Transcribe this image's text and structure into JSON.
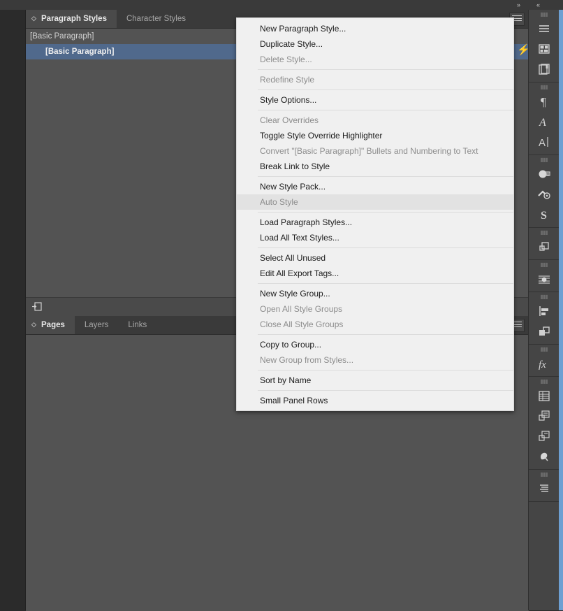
{
  "topbar": {
    "expand_icon": "double-chevron-right",
    "collapse_icon": "double-chevron-left",
    "expand_glyph": "»",
    "collapse_glyph": "«"
  },
  "paragraph_styles_panel": {
    "tabs": [
      {
        "label": "Paragraph Styles",
        "active": true
      },
      {
        "label": "Character Styles",
        "active": false
      }
    ],
    "header_label": "[Basic Paragraph]",
    "rows": [
      {
        "label": "[Basic Paragraph]",
        "selected": true
      }
    ],
    "quick_apply_icon": "lightning-bolt-icon",
    "quick_apply_glyph": "⚡",
    "footer_icon": "new-style-icon",
    "menu_icon": "panel-menu-icon"
  },
  "pages_panel": {
    "tabs": [
      {
        "label": "Pages",
        "active": true
      },
      {
        "label": "Layers",
        "active": false
      },
      {
        "label": "Links",
        "active": false
      }
    ],
    "menu_icon": "panel-menu-icon"
  },
  "context_menu": {
    "items": [
      {
        "label": "New Paragraph Style...",
        "disabled": false,
        "hover": false,
        "sep_after": false
      },
      {
        "label": "Duplicate Style...",
        "disabled": false,
        "hover": false,
        "sep_after": false
      },
      {
        "label": "Delete Style...",
        "disabled": true,
        "hover": false,
        "sep_after": true
      },
      {
        "label": "Redefine Style",
        "disabled": true,
        "hover": false,
        "sep_after": true
      },
      {
        "label": "Style Options...",
        "disabled": false,
        "hover": false,
        "sep_after": true
      },
      {
        "label": "Clear Overrides",
        "disabled": true,
        "hover": false,
        "sep_after": false
      },
      {
        "label": "Toggle Style Override Highlighter",
        "disabled": false,
        "hover": false,
        "sep_after": false
      },
      {
        "label": "Convert \"[Basic Paragraph]\" Bullets and Numbering to Text",
        "disabled": true,
        "hover": false,
        "sep_after": false
      },
      {
        "label": "Break Link to Style",
        "disabled": false,
        "hover": false,
        "sep_after": true
      },
      {
        "label": "New Style Pack...",
        "disabled": false,
        "hover": false,
        "sep_after": false
      },
      {
        "label": "Auto Style",
        "disabled": true,
        "hover": true,
        "sep_after": true
      },
      {
        "label": "Load Paragraph Styles...",
        "disabled": false,
        "hover": false,
        "sep_after": false
      },
      {
        "label": "Load All Text Styles...",
        "disabled": false,
        "hover": false,
        "sep_after": true
      },
      {
        "label": "Select All Unused",
        "disabled": false,
        "hover": false,
        "sep_after": false
      },
      {
        "label": "Edit All Export Tags...",
        "disabled": false,
        "hover": false,
        "sep_after": true
      },
      {
        "label": "New Style Group...",
        "disabled": false,
        "hover": false,
        "sep_after": false
      },
      {
        "label": "Open All Style Groups",
        "disabled": true,
        "hover": false,
        "sep_after": false
      },
      {
        "label": "Close All Style Groups",
        "disabled": true,
        "hover": false,
        "sep_after": true
      },
      {
        "label": "Copy to Group...",
        "disabled": false,
        "hover": false,
        "sep_after": false
      },
      {
        "label": "New Group from Styles...",
        "disabled": true,
        "hover": false,
        "sep_after": true
      },
      {
        "label": "Sort by Name",
        "disabled": false,
        "hover": false,
        "sep_after": true
      },
      {
        "label": "Small Panel Rows",
        "disabled": false,
        "hover": false,
        "sep_after": false
      }
    ]
  },
  "icon_rail": {
    "groups": [
      {
        "icons": [
          {
            "name": "pages-panel-icon",
            "glyph": "☰"
          },
          {
            "name": "layout-grid-icon",
            "glyph": "▦"
          },
          {
            "name": "book-pages-icon",
            "glyph": "❐"
          }
        ]
      },
      {
        "icons": [
          {
            "name": "paragraph-styles-icon",
            "glyph": "¶"
          },
          {
            "name": "character-styles-icon",
            "glyph": "𝒜"
          },
          {
            "name": "text-frame-icon",
            "glyph": "A"
          }
        ]
      },
      {
        "icons": [
          {
            "name": "color-icon",
            "glyph": "◕"
          },
          {
            "name": "swatches-icon",
            "glyph": "✻"
          },
          {
            "name": "gradient-icon",
            "glyph": "◩"
          }
        ]
      },
      {
        "icons": [
          {
            "name": "pathfinder-icon",
            "glyph": "❐"
          }
        ]
      },
      {
        "icons": [
          {
            "name": "effects-stroke-icon",
            "glyph": "◎"
          }
        ]
      },
      {
        "icons": [
          {
            "name": "align-icon",
            "glyph": "≡"
          },
          {
            "name": "layers-icon",
            "glyph": "❐"
          }
        ]
      },
      {
        "icons": [
          {
            "name": "effects-fx-icon",
            "glyph": "fx"
          }
        ]
      },
      {
        "icons": [
          {
            "name": "table-icon",
            "glyph": "▦"
          },
          {
            "name": "object-styles-icon",
            "glyph": "❐"
          },
          {
            "name": "cell-styles-icon",
            "glyph": "❐"
          },
          {
            "name": "hyperlinks-icon",
            "glyph": "✋"
          }
        ]
      },
      {
        "icons": [
          {
            "name": "paragraph-align-icon",
            "glyph": "≡"
          }
        ]
      }
    ]
  }
}
